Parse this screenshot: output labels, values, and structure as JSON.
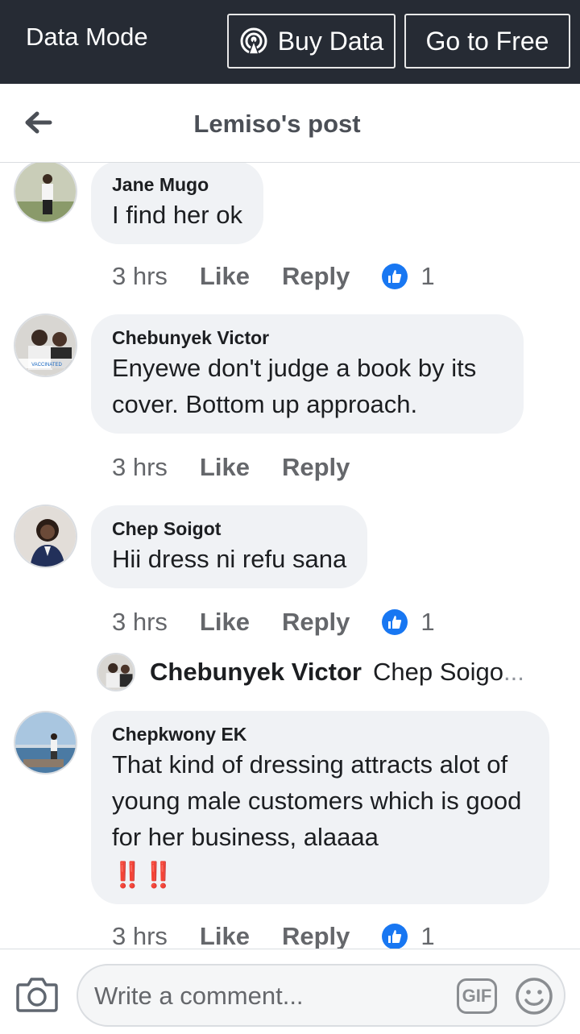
{
  "data_mode": {
    "label": "Data Mode",
    "buy_label": "Buy Data",
    "free_label": "Go to Free"
  },
  "header": {
    "title": "Lemiso's post"
  },
  "comments": [
    {
      "author": "Jane Mugo",
      "text": "I find her ok",
      "time": "3 hrs",
      "like": "Like",
      "reply": "Reply",
      "reactions": "1"
    },
    {
      "author": "Chebunyek Victor",
      "text": "Enyewe don't judge a book by its cover. Bottom up approach.",
      "time": "3 hrs",
      "like": "Like",
      "reply": "Reply"
    },
    {
      "author": "Chep Soigot",
      "text": "Hii dress ni refu sana",
      "time": "3 hrs",
      "like": "Like",
      "reply": "Reply",
      "reactions": "1"
    },
    {
      "author": "Chepkwony EK",
      "text": "That kind of dressing attracts alot of young male customers which is good for her business, alaaaa",
      "emoji": "‼️‼️",
      "time": "3 hrs",
      "like": "Like",
      "reply": "Reply",
      "reactions": "1"
    }
  ],
  "reply_preview": {
    "author": "Chebunyek Victor",
    "text": "Chep Soigo",
    "ellipsis": "..."
  },
  "composer": {
    "placeholder": "Write a comment...",
    "gif_label": "GIF"
  },
  "colors": {
    "datamode_bg": "#262b34",
    "bubble_bg": "#f0f2f5",
    "like_blue": "#1877f2"
  }
}
